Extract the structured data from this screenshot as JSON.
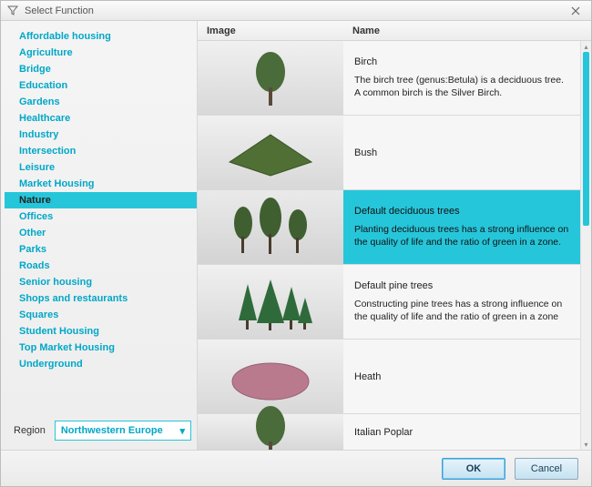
{
  "window": {
    "title": "Select Function"
  },
  "sidebar": {
    "categories": [
      "Affordable housing",
      "Agriculture",
      "Bridge",
      "Education",
      "Gardens",
      "Healthcare",
      "Industry",
      "Intersection",
      "Leisure",
      "Market Housing",
      "Nature",
      "Offices",
      "Other",
      "Parks",
      "Roads",
      "Senior housing",
      "Shops and restaurants",
      "Squares",
      "Student Housing",
      "Top Market Housing",
      "Underground"
    ],
    "selected_index": 10
  },
  "region": {
    "label": "Region",
    "value": "Northwestern Europe"
  },
  "columns": {
    "image": "Image",
    "name": "Name"
  },
  "items": [
    {
      "name": "Birch",
      "desc": "The birch tree (genus:Betula) is a deciduous tree. A common birch is the Silver Birch.",
      "icon": "single-tree"
    },
    {
      "name": "Bush",
      "desc": "",
      "icon": "bush"
    },
    {
      "name": "Default deciduous trees",
      "desc": "Planting deciduous trees has a strong influence on the quality of life and the ratio of green in a zone.",
      "icon": "tree-group"
    },
    {
      "name": "Default pine trees",
      "desc": "Constructing pine trees has a strong influence on the quality of life and the ratio of green in a zone",
      "icon": "pine-group"
    },
    {
      "name": "Heath",
      "desc": "",
      "icon": "heath"
    },
    {
      "name": "Italian Poplar",
      "desc": "",
      "icon": "single-tree"
    }
  ],
  "selected_item_index": 2,
  "buttons": {
    "ok": "OK",
    "cancel": "Cancel"
  }
}
